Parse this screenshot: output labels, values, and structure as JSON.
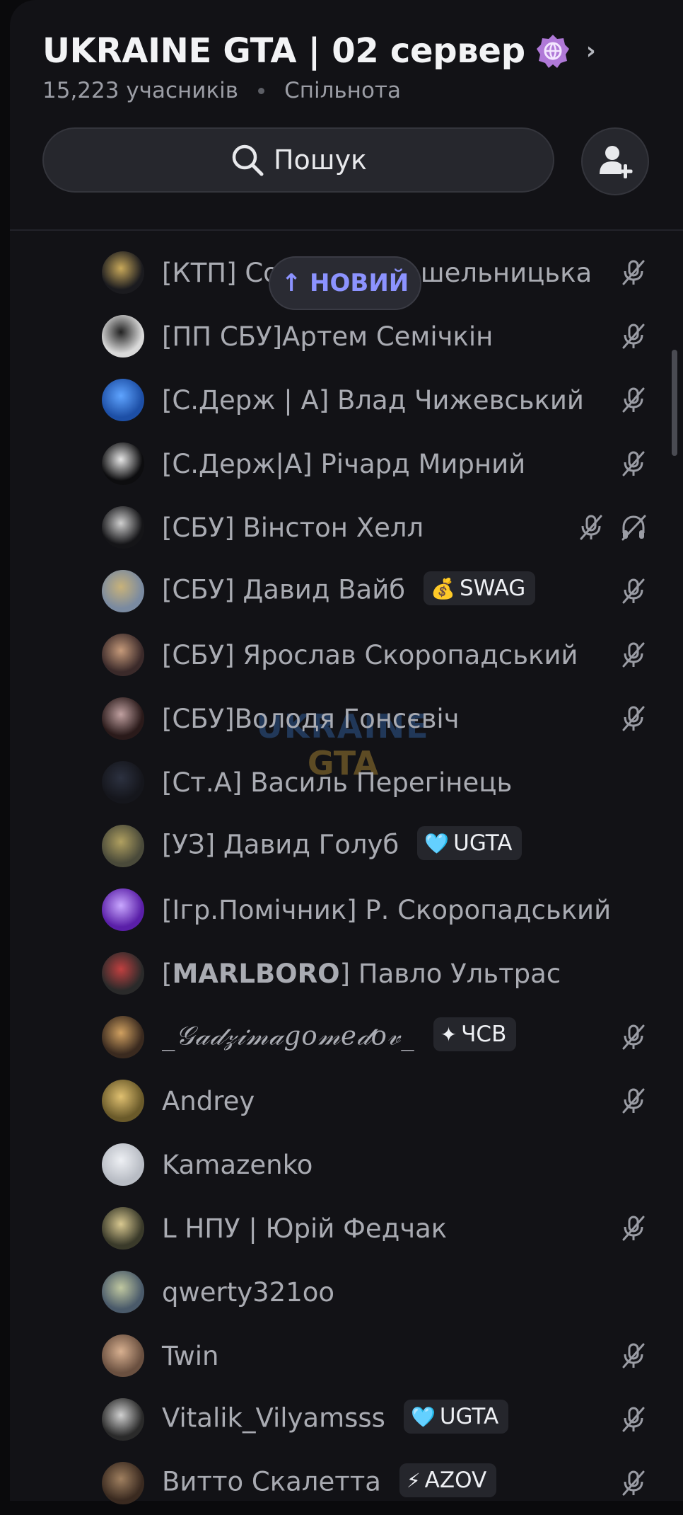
{
  "server": {
    "name": "UKRAINE GTA | 02 сервер",
    "members": "15,223 учасників",
    "type": "Спільнота"
  },
  "search": {
    "label": "Пошук"
  },
  "new_pill": {
    "label": "↑ НОВИЙ"
  },
  "watermark": {
    "line1": "UKRAINE",
    "line2": "GTA"
  },
  "members": [
    {
      "name": "[КТП] Со",
      "name_tail": "шельницька",
      "tag": "",
      "tag_icon": "",
      "muted": true,
      "deafened": false
    },
    {
      "name": "[ПП СБУ]Артем Семічкін",
      "tag": "",
      "muted": true
    },
    {
      "name": "[С.Держ | А] Влад Чижевський",
      "tag": "",
      "muted": true
    },
    {
      "name": "[С.Держ|А] Річард Мирний",
      "tag": "",
      "muted": true
    },
    {
      "name": "[СБУ] Вінстон Хелл",
      "tag": "",
      "muted": true,
      "deafened": true
    },
    {
      "name": "[СБУ] Давид Вайб",
      "tag": "SWAG",
      "tag_icon": "💰",
      "muted": true
    },
    {
      "name": "[СБУ] Ярослав Скоропадський",
      "tag": "",
      "muted": true
    },
    {
      "name": "[СБУ]Володя Гонсєвіч",
      "tag": "",
      "muted": true
    },
    {
      "name": "[Ст.А] Василь Перегінець",
      "tag": "",
      "muted": false
    },
    {
      "name": "[УЗ] Давид Голуб",
      "tag": "UGTA",
      "tag_icon": "🩵",
      "muted": false
    },
    {
      "name": "[Ігр.Помічник] Р. Скоропадський",
      "tag": "",
      "muted": false
    },
    {
      "name_prefix": "[",
      "name_bold": "MARLBORO",
      "name_suffix": "] Павло Ультрас",
      "tag": "",
      "muted": false
    },
    {
      "name": "_𝒢𝒶𝒹𝓏𝒾𝓂𝒶𝑔𝑜𝓂𝑒𝒹𝑜𝓋_",
      "tag": "ЧСВ",
      "tag_icon": "✦",
      "muted": true
    },
    {
      "name": "Andrey",
      "tag": "",
      "muted": true
    },
    {
      "name": "Kamazenko",
      "tag": "",
      "muted": false
    },
    {
      "name": "L НПУ | Юрій Федчак",
      "tag": "",
      "muted": true
    },
    {
      "name": "qwerty321oo",
      "tag": "",
      "muted": false
    },
    {
      "name": "Twin",
      "tag": "",
      "muted": true
    },
    {
      "name": "Vitalik_Vilyamsss",
      "tag": "UGTA",
      "tag_icon": "🩵",
      "muted": true
    },
    {
      "name": "Витто Скалетта",
      "tag": "AZOV",
      "tag_icon": "⚡",
      "muted": true
    }
  ]
}
